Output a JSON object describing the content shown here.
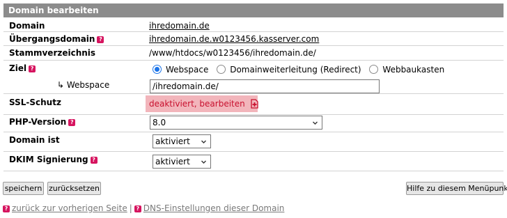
{
  "header": {
    "title": "Domain bearbeiten"
  },
  "rows": {
    "domain": {
      "label": "Domain",
      "value": "ihredomain.de"
    },
    "transition": {
      "label": "Übergangsdomain",
      "value": "ihredomain.de.w0123456.kasserver.com"
    },
    "root": {
      "label": "Stammverzeichnis",
      "value": "/www/htdocs/w0123456/ihredomain.de/"
    },
    "target": {
      "label": "Ziel",
      "options": [
        "Webspace",
        "Domainweiterleitung (Redirect)",
        "Webbaukasten"
      ],
      "selected": "Webspace"
    },
    "webspace": {
      "label": "↳ Webspace",
      "value": "/ihredomain.de/"
    },
    "ssl": {
      "label": "SSL-Schutz",
      "value": "deaktiviert, bearbeiten"
    },
    "php": {
      "label": "PHP-Version",
      "value": "8.0"
    },
    "domain_status": {
      "label": "Domain ist",
      "value": "aktiviert"
    },
    "dkim": {
      "label": "DKIM Signierung",
      "value": "aktiviert"
    }
  },
  "buttons": {
    "save": "speichern",
    "reset": "zurücksetzen",
    "help": "Hilfe zu diesem Menüpunkt"
  },
  "footer": {
    "back": "zurück zur vorherigen Seite",
    "separator": "|",
    "dns": "DNS-Einstellungen dieser Domain"
  },
  "icons": {
    "help": "help-icon",
    "ssl_edit": "add-document-icon",
    "caret": "chevron-down-icon"
  },
  "colors": {
    "header_bg": "#8c8c8c",
    "help_icon": "#d6145f",
    "ssl_bg": "#f2b5bb",
    "ssl_text": "#c8102e",
    "radio_selected": "#1a73e8"
  }
}
